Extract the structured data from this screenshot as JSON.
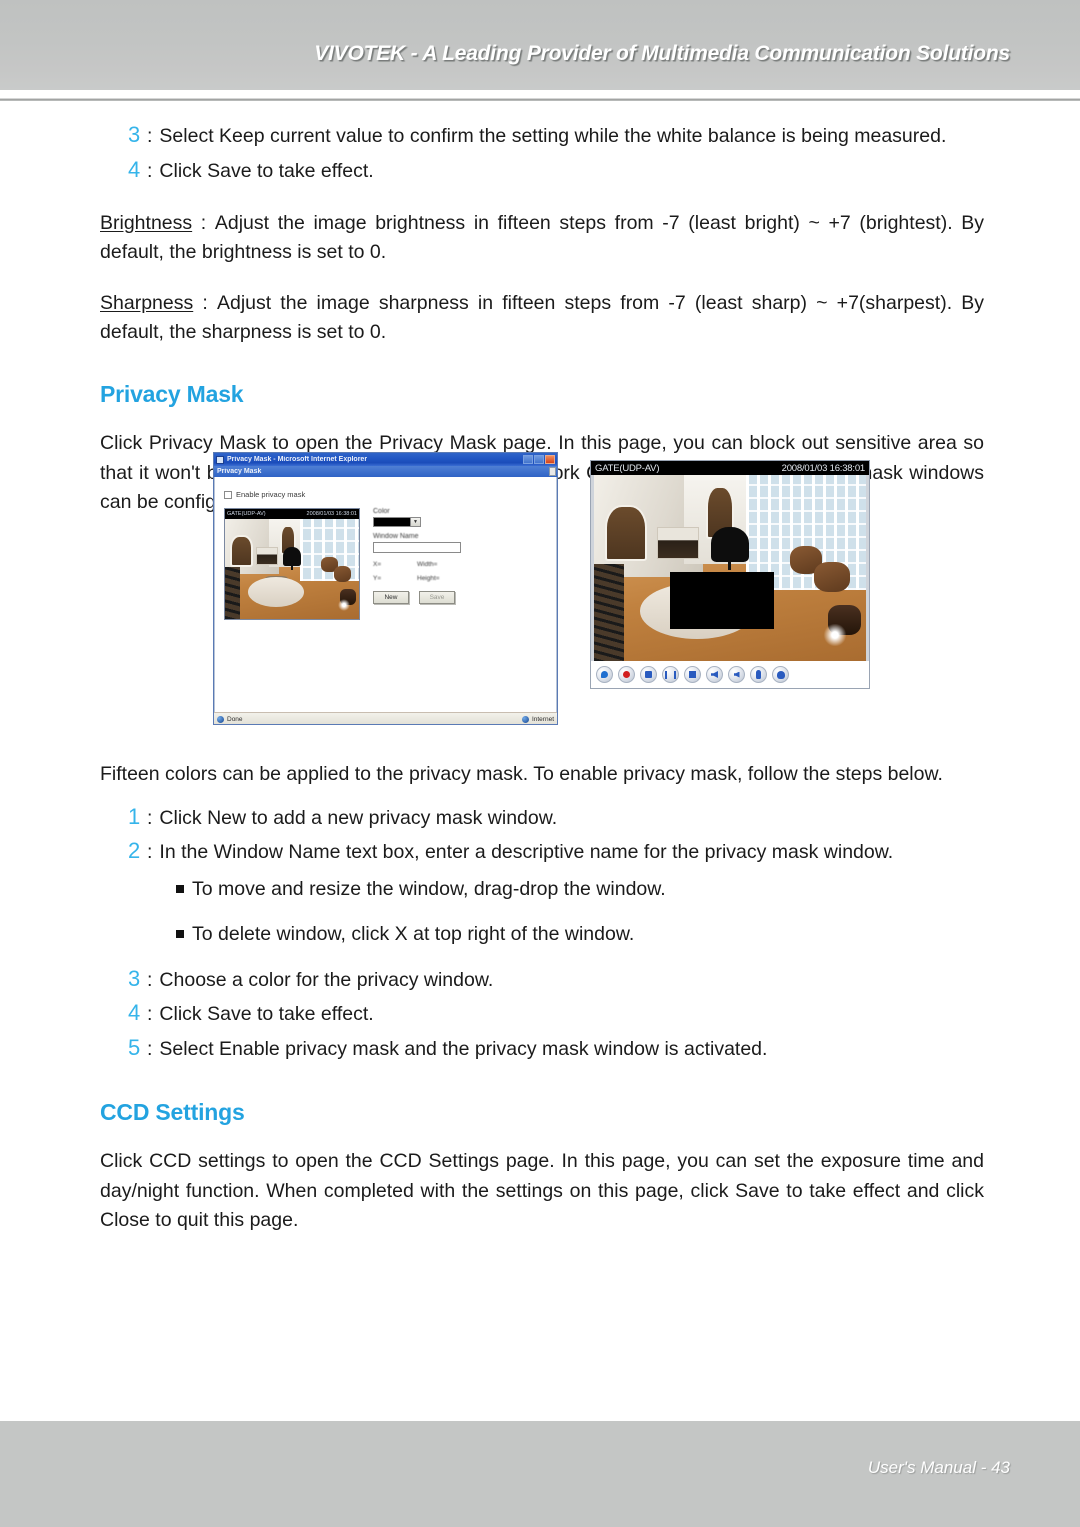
{
  "header": {
    "title": "VIVOTEK - A Leading Provider of Multimedia Communication Solutions"
  },
  "footer": {
    "text": "User's Manual - 43"
  },
  "top_steps": [
    {
      "num": "3",
      "colon": ":",
      "text": "Select Keep current value to confirm the setting while the white balance is being measured."
    },
    {
      "num": "4",
      "colon": ":",
      "text": "Click Save to take effect."
    }
  ],
  "definitions": [
    {
      "term": "Brightness",
      "colon": ":",
      "text": "Adjust the image brightness in fifteen steps from -7 (least bright) ~ +7 (brightest). By default, the brightness is set to 0."
    },
    {
      "term": "Sharpness",
      "colon": ":",
      "text": "Adjust the image sharpness in fifteen steps from -7 (least sharp) ~ +7(sharpest). By default, the sharpness is set to 0."
    }
  ],
  "privacy_mask": {
    "heading": "Privacy Mask",
    "paragraph": "Click Privacy Mask to open the Privacy Mask page. In this page, you can block out sensitive area so that it won't be seen by anyone accessing the Network Camera. A total of five privacy mask windows can be configured.",
    "intro": "Fifteen colors can be applied to the privacy mask. To enable privacy mask, follow the steps below.",
    "steps": [
      {
        "num": "1",
        "colon": ":",
        "text": "Click New to add a new privacy mask window."
      },
      {
        "num": "2",
        "colon": ":",
        "text": "In the Window Name text box, enter a descriptive name for the privacy mask window."
      },
      {
        "num": "3",
        "colon": ":",
        "text": "Choose a color for the privacy window."
      },
      {
        "num": "4",
        "colon": ":",
        "text": "Click Save to take effect."
      },
      {
        "num": "5",
        "colon": ":",
        "text": "Select Enable privacy mask and the privacy mask window is activated."
      }
    ],
    "bullets": [
      "To move and resize the window, drag-drop the window.",
      "To delete window, click X  at top right of the window."
    ]
  },
  "ccd_settings": {
    "heading": "CCD Settings",
    "paragraph": "Click CCD settings to open the CCD Settings page. In this page, you can set the exposure time and day/night function. When completed with the settings on this page, click Save to take effect and click Close to quit this page."
  },
  "figures": {
    "ie_window": {
      "title": "Privacy Mask - Microsoft Internet Explorer",
      "address": "Privacy Mask",
      "enable_checkbox_label": "Enable privacy mask",
      "preview_bar_left": "GATE(UDP-AV)",
      "preview_bar_right": "2008/01/03 16:38:01",
      "form": {
        "color_label": "Color",
        "color_value": "#000000",
        "dropdown_arrow": "▼",
        "window_name_label": "Window Name",
        "window_name_value": "",
        "x_label": "X=",
        "width_label": "Width=",
        "y_label": "Y=",
        "height_label": "Height=",
        "new_button": "New",
        "save_button": "Save"
      },
      "status_left": "Done",
      "status_right": "Internet"
    },
    "live_view": {
      "bar_left": "GATE(UDP-AV)",
      "bar_right": "2008/01/03 16:38:01",
      "controls": [
        "search-icon",
        "record-icon",
        "snapshot-icon",
        "pause-icon",
        "stop-icon",
        "volume-icon",
        "mute-icon",
        "microphone-icon",
        "talk-icon"
      ]
    }
  },
  "colors": {
    "heading_blue": "#23a3e0",
    "step_number_blue": "#35b4ea",
    "band_gray": "#c4c6c5",
    "body_text": "#1b1b1b"
  }
}
